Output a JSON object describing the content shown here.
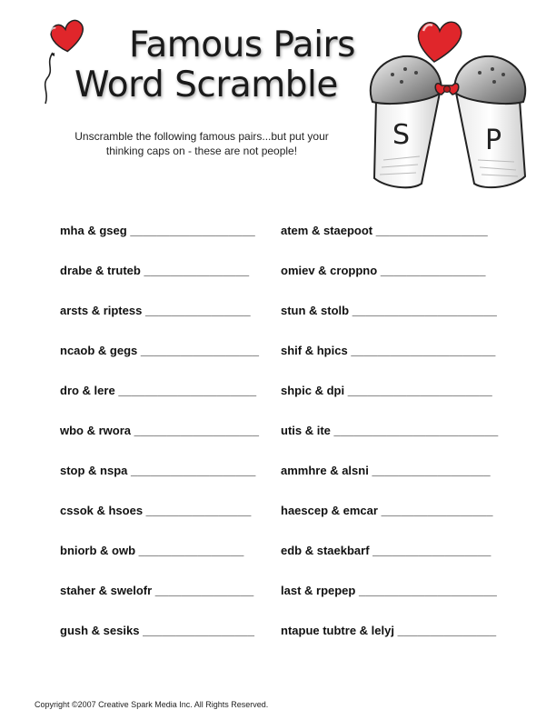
{
  "title": {
    "line1": "Famous Pairs",
    "line2": "Word Scramble"
  },
  "instructions": "Unscramble the following famous pairs...but put your thinking caps on - these are not people!",
  "shaker_letters": {
    "left": "S",
    "right": "P"
  },
  "puzzles": {
    "left": [
      {
        "scramble": "mha & gseg",
        "blank": "___________________"
      },
      {
        "scramble": "drabe & truteb",
        "blank": "________________"
      },
      {
        "scramble": "arsts & riptess",
        "blank": "________________"
      },
      {
        "scramble": "ncaob & gegs",
        "blank": "__________________"
      },
      {
        "scramble": "dro & lere",
        "blank": "_____________________"
      },
      {
        "scramble": "wbo & rwora",
        "blank": "___________________"
      },
      {
        "scramble": "stop & nspa",
        "blank": "___________________"
      },
      {
        "scramble": "cssok & hsoes",
        "blank": "________________"
      },
      {
        "scramble": "bniorb & owb",
        "blank": "________________"
      },
      {
        "scramble": "staher & swelofr",
        "blank": "_______________"
      },
      {
        "scramble": "gush & sesiks",
        "blank": "_________________"
      }
    ],
    "right": [
      {
        "scramble": "atem & staepoot",
        "blank": "_________________"
      },
      {
        "scramble": "omiev & croppno",
        "blank": "________________"
      },
      {
        "scramble": "stun & stolb",
        "blank": "______________________"
      },
      {
        "scramble": "shif & hpics",
        "blank": "______________________"
      },
      {
        "scramble": "shpic & dpi",
        "blank": "______________________"
      },
      {
        "scramble": "utis & ite",
        "blank": "_________________________"
      },
      {
        "scramble": "ammhre & alsni",
        "blank": "__________________"
      },
      {
        "scramble": "haescep & emcar",
        "blank": "_________________"
      },
      {
        "scramble": "edb & staekbarf",
        "blank": "__________________"
      },
      {
        "scramble": "last & rpepep",
        "blank": "_____________________"
      },
      {
        "scramble": "ntapue tubtre & lelyj",
        "blank": "_______________"
      }
    ]
  },
  "copyright": "Copyright ©2007  Creative Spark Media Inc.  All Rights Reserved.",
  "colors": {
    "heart": "#e0262b",
    "text": "#111111"
  }
}
